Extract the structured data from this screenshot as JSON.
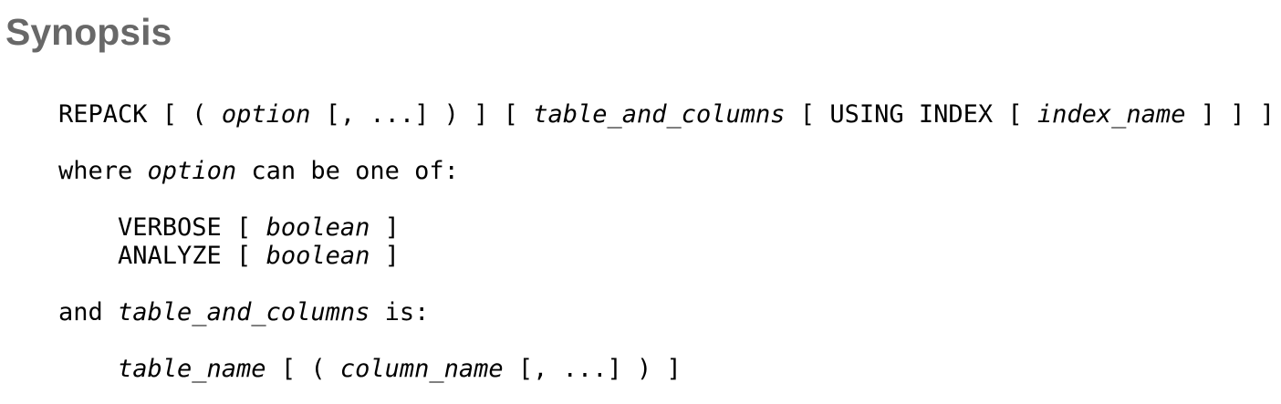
{
  "section": {
    "title": "Synopsis"
  },
  "synopsis": {
    "line1": {
      "a": "REPACK [ ( ",
      "option": "option",
      "b": " [, ...] ) ] [ ",
      "table_and_columns": "table_and_columns",
      "c": " [ USING INDEX [ ",
      "index_name": "index_name",
      "d": " ] ] ]"
    },
    "line2": {
      "a": "where ",
      "option": "option",
      "b": " can be one of:"
    },
    "line3": {
      "a": "VERBOSE [ ",
      "boolean": "boolean",
      "b": " ]"
    },
    "line4": {
      "a": "ANALYZE [ ",
      "boolean": "boolean",
      "b": " ]"
    },
    "line5": {
      "a": "and ",
      "table_and_columns": "table_and_columns",
      "b": " is:"
    },
    "line6": {
      "table_name": "table_name",
      "a": " [ ( ",
      "column_name": "column_name",
      "b": " [, ...] ) ]"
    }
  }
}
